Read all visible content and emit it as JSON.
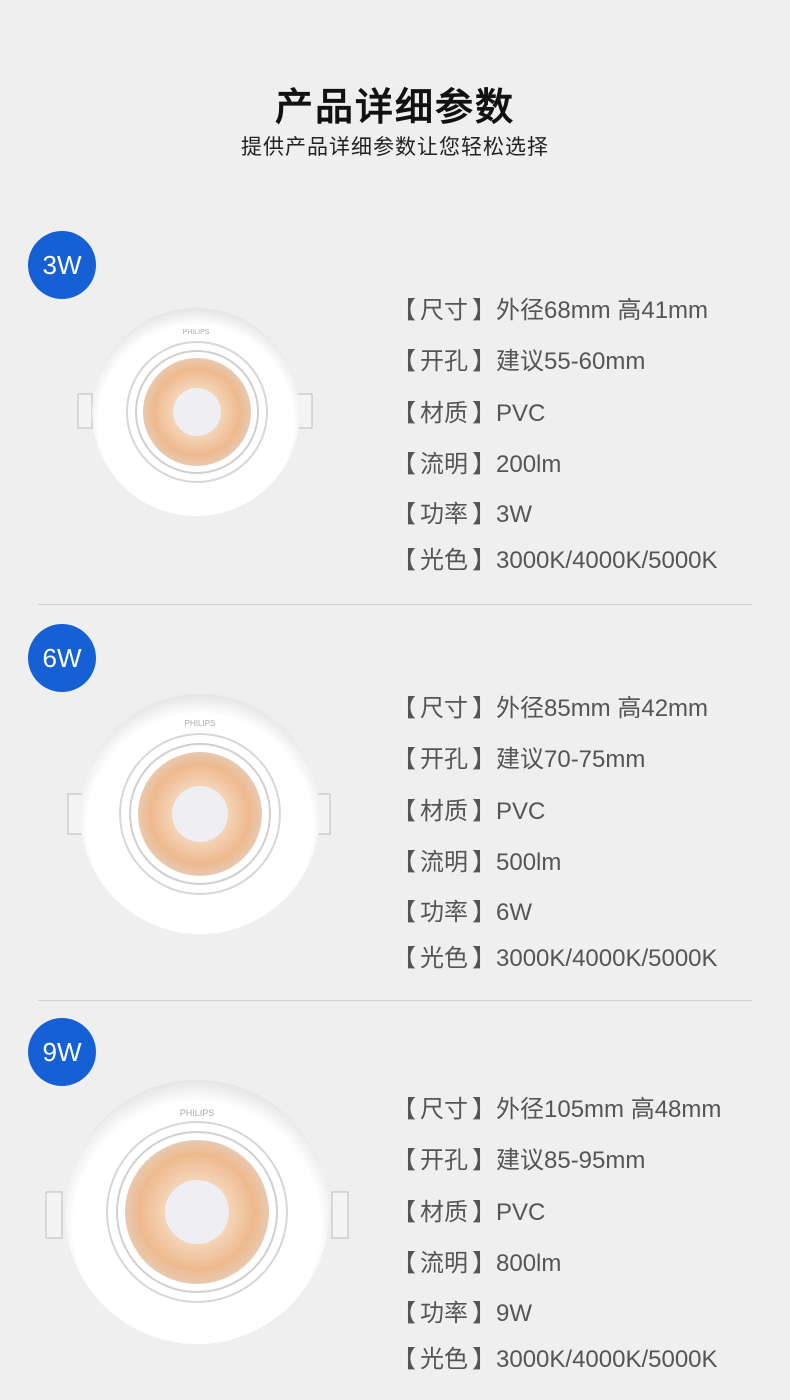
{
  "header": {
    "title": "产品详细参数",
    "subtitle": "提供产品详细参数让您轻松选择"
  },
  "products": [
    {
      "badge": "3W",
      "specs": [
        {
          "label": "尺寸",
          "value": "外径68mm 高41mm"
        },
        {
          "label": "开孔",
          "value": "建议55-60mm"
        },
        {
          "label": "材质",
          "value": "PVC"
        },
        {
          "label": "流明",
          "value": "200lm"
        },
        {
          "label": "功率",
          "value": "3W"
        },
        {
          "label": "光色",
          "value": "3000K/4000K/5000K"
        }
      ]
    },
    {
      "badge": "6W",
      "specs": [
        {
          "label": "尺寸",
          "value": "外径85mm 高42mm"
        },
        {
          "label": "开孔",
          "value": "建议70-75mm"
        },
        {
          "label": "材质",
          "value": "PVC"
        },
        {
          "label": "流明",
          "value": "500lm"
        },
        {
          "label": "功率",
          "value": "6W"
        },
        {
          "label": "光色",
          "value": "3000K/4000K/5000K"
        }
      ]
    },
    {
      "badge": "9W",
      "specs": [
        {
          "label": "尺寸",
          "value": "外径105mm 高48mm"
        },
        {
          "label": "开孔",
          "value": "建议85-95mm"
        },
        {
          "label": "材质",
          "value": "PVC"
        },
        {
          "label": "流明",
          "value": "800lm"
        },
        {
          "label": "功率",
          "value": "9W"
        },
        {
          "label": "光色",
          "value": "3000K/4000K/5000K"
        }
      ]
    }
  ],
  "brand": "PHILIPS",
  "bracket_open": "【",
  "bracket_close": "】",
  "colors": {
    "badge": "#1660d6",
    "background": "#efefef",
    "text": "#555555"
  }
}
